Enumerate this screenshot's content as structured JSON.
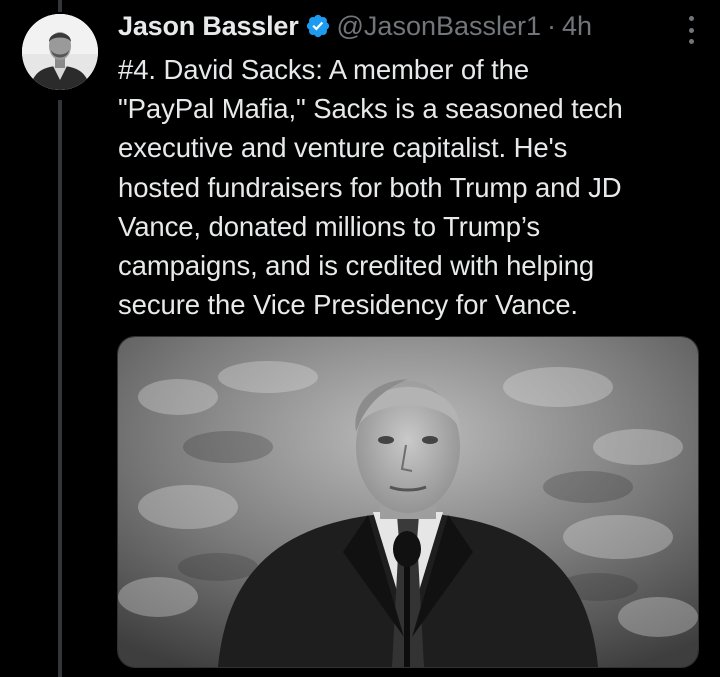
{
  "tweet": {
    "author": {
      "display_name": "Jason Bassler",
      "handle": "@JasonBassler1",
      "avatar_icon": "profile-photo-man",
      "verified_icon": "verified-badge-icon",
      "verified_color": "#1d9bf0"
    },
    "separator": "·",
    "time": "4h",
    "more_icon": "more-vertical-icon",
    "text": "#4. David Sacks: A member of the\n\"PayPal Mafia,\" Sacks is a seasoned tech\nexecutive and venture capitalist. He's\nhosted fundraisers for both Trump and JD\nVance, donated millions to Trump’s\ncampaigns, and is credited with helping\nsecure the Vice Presidency for Vance.",
    "media": {
      "type": "photo",
      "style": "black-and-white"
    }
  },
  "colors": {
    "background": "#000000",
    "primary_text": "#e7e9ea",
    "secondary_text": "#71767b",
    "thread_line": "#333639"
  }
}
